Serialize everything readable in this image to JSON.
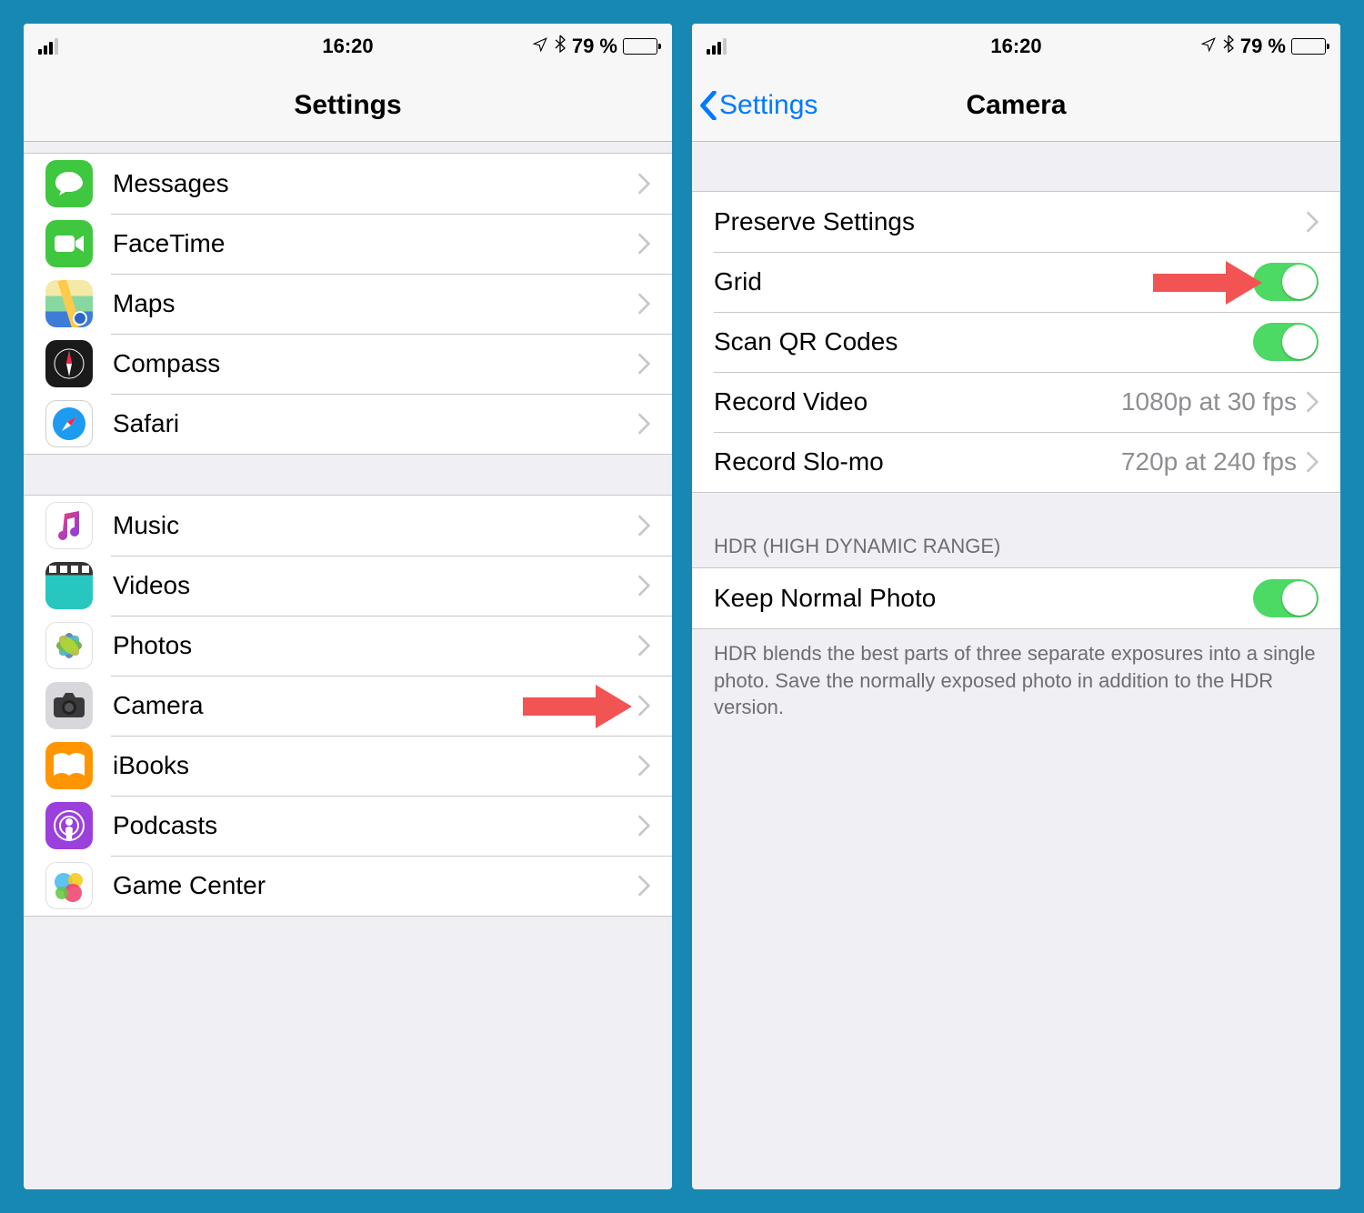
{
  "status": {
    "time": "16:20",
    "battery_text": "79 %"
  },
  "left": {
    "title": "Settings",
    "group1": [
      {
        "label": "Messages"
      },
      {
        "label": "FaceTime"
      },
      {
        "label": "Maps"
      },
      {
        "label": "Compass"
      },
      {
        "label": "Safari"
      }
    ],
    "group2": [
      {
        "label": "Music"
      },
      {
        "label": "Videos"
      },
      {
        "label": "Photos"
      },
      {
        "label": "Camera"
      },
      {
        "label": "iBooks"
      },
      {
        "label": "Podcasts"
      },
      {
        "label": "Game Center"
      }
    ]
  },
  "right": {
    "back_label": "Settings",
    "title": "Camera",
    "rows": {
      "preserve": "Preserve Settings",
      "grid": "Grid",
      "scanqr": "Scan QR Codes",
      "record_video_label": "Record Video",
      "record_video_value": "1080p at 30 fps",
      "record_slomo_label": "Record Slo-mo",
      "record_slomo_value": "720p at 240 fps"
    },
    "hdr_header": "HDR (High Dynamic Range)",
    "keep_normal": "Keep Normal Photo",
    "hdr_footer": "HDR blends the best parts of three separate exposures into a single photo. Save the normally exposed photo in addition to the HDR version."
  }
}
